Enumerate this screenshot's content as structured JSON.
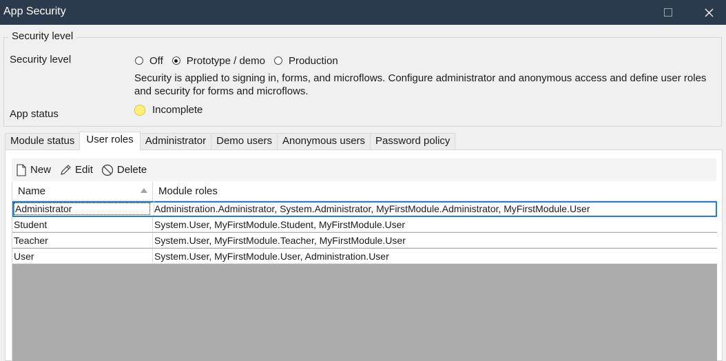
{
  "window": {
    "title": "App Security",
    "maximize_icon": "maximize-icon",
    "close_icon": "close-icon"
  },
  "security_group": {
    "legend": "Security level",
    "level_label": "Security level",
    "options": [
      {
        "label": "Off",
        "checked": false
      },
      {
        "label": "Prototype / demo",
        "checked": true
      },
      {
        "label": "Production",
        "checked": false
      }
    ],
    "description": "Security is applied to signing in, forms, and microflows. Configure administrator and anonymous access and define user roles and security for forms and microflows.",
    "status_label": "App status",
    "status_value": "Incomplete",
    "status_color": "#fff176"
  },
  "tabs": [
    {
      "label": "Module status",
      "active": false
    },
    {
      "label": "User roles",
      "active": true
    },
    {
      "label": "Administrator",
      "active": false
    },
    {
      "label": "Demo users",
      "active": false
    },
    {
      "label": "Anonymous users",
      "active": false
    },
    {
      "label": "Password policy",
      "active": false
    }
  ],
  "toolbar": {
    "new_label": "New",
    "edit_label": "Edit",
    "delete_label": "Delete"
  },
  "grid": {
    "columns": [
      "Name",
      "Module roles"
    ],
    "rows": [
      {
        "name": "Administrator",
        "roles": "Administration.Administrator, System.Administrator, MyFirstModule.Administrator, MyFirstModule.User",
        "selected": true
      },
      {
        "name": "Student",
        "roles": "System.User, MyFirstModule.Student, MyFirstModule.User",
        "selected": false
      },
      {
        "name": "Teacher",
        "roles": "System.User, MyFirstModule.Teacher, MyFirstModule.User",
        "selected": false
      },
      {
        "name": "User",
        "roles": "System.User, MyFirstModule.User, Administration.User",
        "selected": false
      }
    ],
    "selection_color": "#1c7fd6"
  }
}
